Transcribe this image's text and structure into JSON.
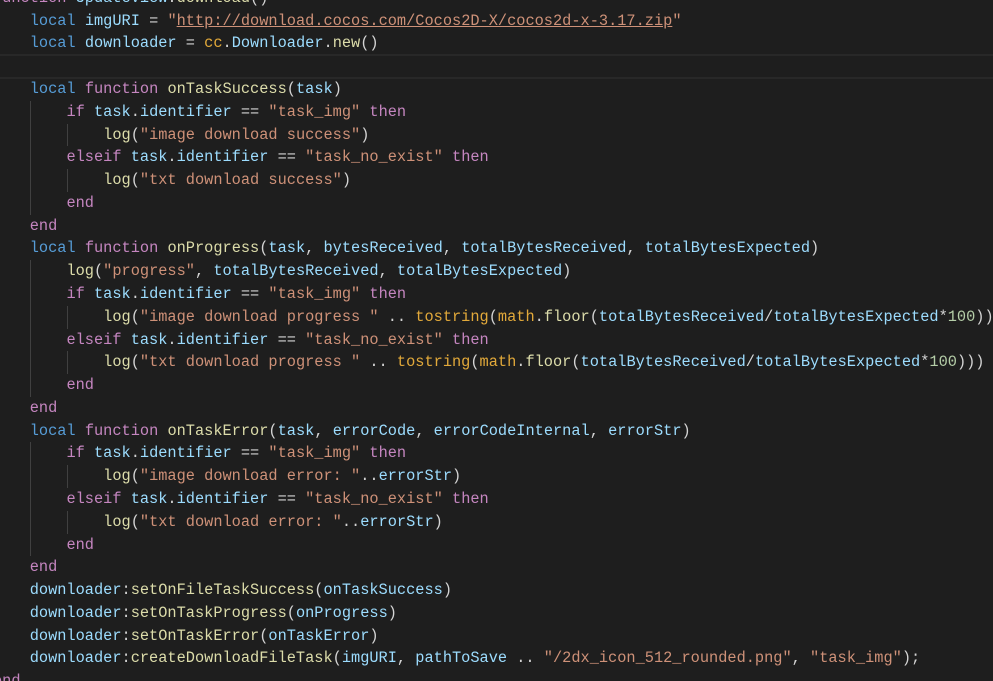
{
  "editor": {
    "current_line": 3,
    "lines": [
      [
        [
          "ctl",
          "function"
        ],
        [
          "pl",
          " "
        ],
        [
          "var",
          "UpdateView"
        ],
        [
          "pl",
          "."
        ],
        [
          "fn",
          "download"
        ],
        [
          "pl",
          "()"
        ]
      ],
      [
        [
          "pl",
          "    "
        ],
        [
          "kw",
          "local"
        ],
        [
          "pl",
          " "
        ],
        [
          "var",
          "imgURI"
        ],
        [
          "pl",
          " = "
        ],
        [
          "str",
          "\""
        ],
        [
          "link",
          "http://download.cocos.com/Cocos2D-X/cocos2d-x-3.17.zip"
        ],
        [
          "str",
          "\""
        ]
      ],
      [
        [
          "pl",
          "    "
        ],
        [
          "kw",
          "local"
        ],
        [
          "pl",
          " "
        ],
        [
          "var",
          "downloader"
        ],
        [
          "pl",
          " = "
        ],
        [
          "bi",
          "cc"
        ],
        [
          "pl",
          "."
        ],
        [
          "var",
          "Downloader"
        ],
        [
          "pl",
          "."
        ],
        [
          "fn",
          "new"
        ],
        [
          "pl",
          "()"
        ]
      ],
      [],
      [
        [
          "pl",
          "    "
        ],
        [
          "kw",
          "local"
        ],
        [
          "pl",
          " "
        ],
        [
          "ctl",
          "function"
        ],
        [
          "pl",
          " "
        ],
        [
          "fn",
          "onTaskSuccess"
        ],
        [
          "pl",
          "("
        ],
        [
          "var",
          "task"
        ],
        [
          "pl",
          ")"
        ]
      ],
      [
        [
          "pl",
          "        "
        ],
        [
          "ctl",
          "if"
        ],
        [
          "pl",
          " "
        ],
        [
          "var",
          "task"
        ],
        [
          "pl",
          "."
        ],
        [
          "var",
          "identifier"
        ],
        [
          "pl",
          " == "
        ],
        [
          "str",
          "\"task_img\""
        ],
        [
          "pl",
          " "
        ],
        [
          "ctl",
          "then"
        ]
      ],
      [
        [
          "pl",
          "            "
        ],
        [
          "fn",
          "log"
        ],
        [
          "pl",
          "("
        ],
        [
          "str",
          "\"image download success\""
        ],
        [
          "pl",
          ")"
        ]
      ],
      [
        [
          "pl",
          "        "
        ],
        [
          "ctl",
          "elseif"
        ],
        [
          "pl",
          " "
        ],
        [
          "var",
          "task"
        ],
        [
          "pl",
          "."
        ],
        [
          "var",
          "identifier"
        ],
        [
          "pl",
          " == "
        ],
        [
          "str",
          "\"task_no_exist\""
        ],
        [
          "pl",
          " "
        ],
        [
          "ctl",
          "then"
        ]
      ],
      [
        [
          "pl",
          "            "
        ],
        [
          "fn",
          "log"
        ],
        [
          "pl",
          "("
        ],
        [
          "str",
          "\"txt download success\""
        ],
        [
          "pl",
          ")"
        ]
      ],
      [
        [
          "pl",
          "        "
        ],
        [
          "ctl",
          "end"
        ]
      ],
      [
        [
          "pl",
          "    "
        ],
        [
          "ctl",
          "end"
        ]
      ],
      [
        [
          "pl",
          "    "
        ],
        [
          "kw",
          "local"
        ],
        [
          "pl",
          " "
        ],
        [
          "ctl",
          "function"
        ],
        [
          "pl",
          " "
        ],
        [
          "fn",
          "onProgress"
        ],
        [
          "pl",
          "("
        ],
        [
          "var",
          "task"
        ],
        [
          "pl",
          ", "
        ],
        [
          "var",
          "bytesReceived"
        ],
        [
          "pl",
          ", "
        ],
        [
          "var",
          "totalBytesReceived"
        ],
        [
          "pl",
          ", "
        ],
        [
          "var",
          "totalBytesExpected"
        ],
        [
          "pl",
          ")"
        ]
      ],
      [
        [
          "pl",
          "        "
        ],
        [
          "fn",
          "log"
        ],
        [
          "pl",
          "("
        ],
        [
          "str",
          "\"progress\""
        ],
        [
          "pl",
          ", "
        ],
        [
          "var",
          "totalBytesReceived"
        ],
        [
          "pl",
          ", "
        ],
        [
          "var",
          "totalBytesExpected"
        ],
        [
          "pl",
          ")"
        ]
      ],
      [
        [
          "pl",
          "        "
        ],
        [
          "ctl",
          "if"
        ],
        [
          "pl",
          " "
        ],
        [
          "var",
          "task"
        ],
        [
          "pl",
          "."
        ],
        [
          "var",
          "identifier"
        ],
        [
          "pl",
          " == "
        ],
        [
          "str",
          "\"task_img\""
        ],
        [
          "pl",
          " "
        ],
        [
          "ctl",
          "then"
        ]
      ],
      [
        [
          "pl",
          "            "
        ],
        [
          "fn",
          "log"
        ],
        [
          "pl",
          "("
        ],
        [
          "str",
          "\"image download progress \""
        ],
        [
          "pl",
          " .. "
        ],
        [
          "bi",
          "tostring"
        ],
        [
          "pl",
          "("
        ],
        [
          "bi",
          "math"
        ],
        [
          "pl",
          "."
        ],
        [
          "fn",
          "floor"
        ],
        [
          "pl",
          "("
        ],
        [
          "var",
          "totalBytesReceived"
        ],
        [
          "pl",
          "/"
        ],
        [
          "var",
          "totalBytesExpected"
        ],
        [
          "pl",
          "*"
        ],
        [
          "num",
          "100"
        ],
        [
          "pl",
          ")))"
        ]
      ],
      [
        [
          "pl",
          "        "
        ],
        [
          "ctl",
          "elseif"
        ],
        [
          "pl",
          " "
        ],
        [
          "var",
          "task"
        ],
        [
          "pl",
          "."
        ],
        [
          "var",
          "identifier"
        ],
        [
          "pl",
          " == "
        ],
        [
          "str",
          "\"task_no_exist\""
        ],
        [
          "pl",
          " "
        ],
        [
          "ctl",
          "then"
        ]
      ],
      [
        [
          "pl",
          "            "
        ],
        [
          "fn",
          "log"
        ],
        [
          "pl",
          "("
        ],
        [
          "str",
          "\"txt download progress \""
        ],
        [
          "pl",
          " .. "
        ],
        [
          "bi",
          "tostring"
        ],
        [
          "pl",
          "("
        ],
        [
          "bi",
          "math"
        ],
        [
          "pl",
          "."
        ],
        [
          "fn",
          "floor"
        ],
        [
          "pl",
          "("
        ],
        [
          "var",
          "totalBytesReceived"
        ],
        [
          "pl",
          "/"
        ],
        [
          "var",
          "totalBytesExpected"
        ],
        [
          "pl",
          "*"
        ],
        [
          "num",
          "100"
        ],
        [
          "pl",
          ")))"
        ]
      ],
      [
        [
          "pl",
          "        "
        ],
        [
          "ctl",
          "end"
        ]
      ],
      [
        [
          "pl",
          "    "
        ],
        [
          "ctl",
          "end"
        ]
      ],
      [
        [
          "pl",
          "    "
        ],
        [
          "kw",
          "local"
        ],
        [
          "pl",
          " "
        ],
        [
          "ctl",
          "function"
        ],
        [
          "pl",
          " "
        ],
        [
          "fn",
          "onTaskError"
        ],
        [
          "pl",
          "("
        ],
        [
          "var",
          "task"
        ],
        [
          "pl",
          ", "
        ],
        [
          "var",
          "errorCode"
        ],
        [
          "pl",
          ", "
        ],
        [
          "var",
          "errorCodeInternal"
        ],
        [
          "pl",
          ", "
        ],
        [
          "var",
          "errorStr"
        ],
        [
          "pl",
          ")"
        ]
      ],
      [
        [
          "pl",
          "        "
        ],
        [
          "ctl",
          "if"
        ],
        [
          "pl",
          " "
        ],
        [
          "var",
          "task"
        ],
        [
          "pl",
          "."
        ],
        [
          "var",
          "identifier"
        ],
        [
          "pl",
          " == "
        ],
        [
          "str",
          "\"task_img\""
        ],
        [
          "pl",
          " "
        ],
        [
          "ctl",
          "then"
        ]
      ],
      [
        [
          "pl",
          "            "
        ],
        [
          "fn",
          "log"
        ],
        [
          "pl",
          "("
        ],
        [
          "str",
          "\"image download error: \""
        ],
        [
          "pl",
          ".."
        ],
        [
          "var",
          "errorStr"
        ],
        [
          "pl",
          ")"
        ]
      ],
      [
        [
          "pl",
          "        "
        ],
        [
          "ctl",
          "elseif"
        ],
        [
          "pl",
          " "
        ],
        [
          "var",
          "task"
        ],
        [
          "pl",
          "."
        ],
        [
          "var",
          "identifier"
        ],
        [
          "pl",
          " == "
        ],
        [
          "str",
          "\"task_no_exist\""
        ],
        [
          "pl",
          " "
        ],
        [
          "ctl",
          "then"
        ]
      ],
      [
        [
          "pl",
          "            "
        ],
        [
          "fn",
          "log"
        ],
        [
          "pl",
          "("
        ],
        [
          "str",
          "\"txt download error: \""
        ],
        [
          "pl",
          ".."
        ],
        [
          "var",
          "errorStr"
        ],
        [
          "pl",
          ")"
        ]
      ],
      [
        [
          "pl",
          "        "
        ],
        [
          "ctl",
          "end"
        ]
      ],
      [
        [
          "pl",
          "    "
        ],
        [
          "ctl",
          "end"
        ]
      ],
      [
        [
          "pl",
          "    "
        ],
        [
          "var",
          "downloader"
        ],
        [
          "pl",
          ":"
        ],
        [
          "fn",
          "setOnFileTaskSuccess"
        ],
        [
          "pl",
          "("
        ],
        [
          "var",
          "onTaskSuccess"
        ],
        [
          "pl",
          ")"
        ]
      ],
      [
        [
          "pl",
          "    "
        ],
        [
          "var",
          "downloader"
        ],
        [
          "pl",
          ":"
        ],
        [
          "fn",
          "setOnTaskProgress"
        ],
        [
          "pl",
          "("
        ],
        [
          "var",
          "onProgress"
        ],
        [
          "pl",
          ")"
        ]
      ],
      [
        [
          "pl",
          "    "
        ],
        [
          "var",
          "downloader"
        ],
        [
          "pl",
          ":"
        ],
        [
          "fn",
          "setOnTaskError"
        ],
        [
          "pl",
          "("
        ],
        [
          "var",
          "onTaskError"
        ],
        [
          "pl",
          ")"
        ]
      ],
      [
        [
          "pl",
          "    "
        ],
        [
          "var",
          "downloader"
        ],
        [
          "pl",
          ":"
        ],
        [
          "fn",
          "createDownloadFileTask"
        ],
        [
          "pl",
          "("
        ],
        [
          "var",
          "imgURI"
        ],
        [
          "pl",
          ", "
        ],
        [
          "var",
          "pathToSave"
        ],
        [
          "pl",
          " .. "
        ],
        [
          "str",
          "\"/2dx_icon_512_rounded.png\""
        ],
        [
          "pl",
          ", "
        ],
        [
          "str",
          "\"task_img\""
        ],
        [
          "pl",
          ");"
        ]
      ],
      [
        [
          "ctl",
          "end"
        ]
      ]
    ]
  }
}
